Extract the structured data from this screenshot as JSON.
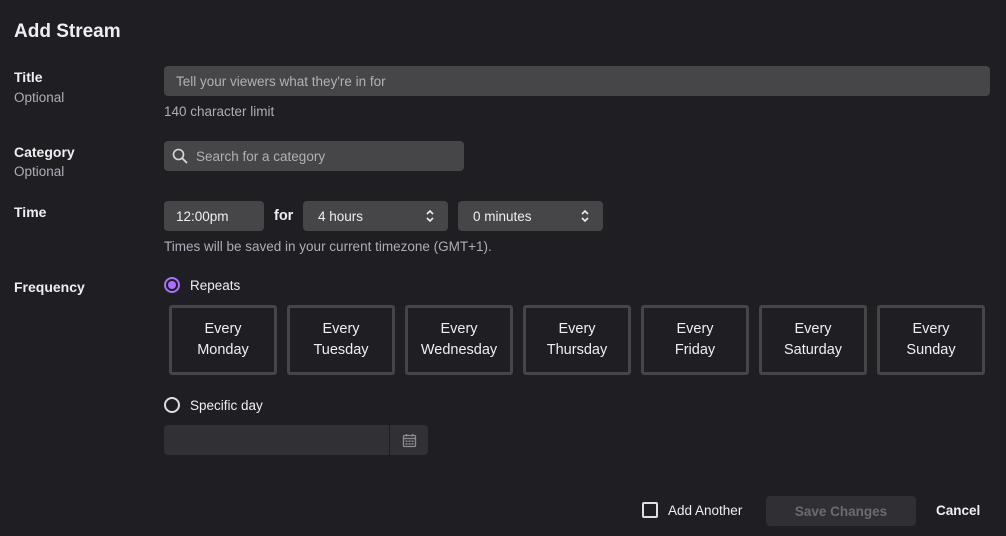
{
  "dialog": {
    "title": "Add Stream"
  },
  "title_field": {
    "label": "Title",
    "sublabel": "Optional",
    "placeholder": "Tell your viewers what they're in for",
    "helper": "140 character limit"
  },
  "category_field": {
    "label": "Category",
    "sublabel": "Optional",
    "placeholder": "Search for a category",
    "icon": "search-icon"
  },
  "time_field": {
    "label": "Time",
    "start": "12:00pm",
    "for_label": "for",
    "hours": "4 hours",
    "minutes": "0 minutes",
    "helper": "Times will be saved in your current timezone (GMT+1)."
  },
  "frequency": {
    "label": "Frequency",
    "repeats_label": "Repeats",
    "repeats_selected": true,
    "days": [
      {
        "line1": "Every",
        "line2": "Monday"
      },
      {
        "line1": "Every",
        "line2": "Tuesday"
      },
      {
        "line1": "Every",
        "line2": "Wednesday"
      },
      {
        "line1": "Every",
        "line2": "Thursday"
      },
      {
        "line1": "Every",
        "line2": "Friday"
      },
      {
        "line1": "Every",
        "line2": "Saturday"
      },
      {
        "line1": "Every",
        "line2": "Sunday"
      }
    ],
    "specific_day_label": "Specific day",
    "date_value": "",
    "date_icon": "calendar-icon"
  },
  "footer": {
    "add_another_label": "Add Another",
    "save_label": "Save Changes",
    "cancel_label": "Cancel"
  },
  "colors": {
    "background": "#1f1f23",
    "input": "#464649",
    "accent": "#a970ff",
    "muted_text": "#adadb8"
  }
}
